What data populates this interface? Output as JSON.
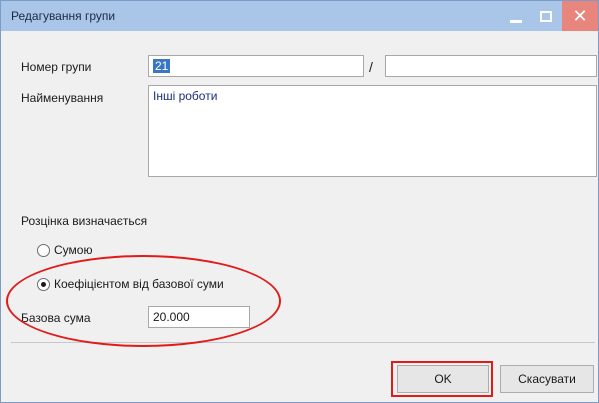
{
  "window": {
    "title": "Редагування групи",
    "controls": {
      "minimize_icon": "minimize-icon",
      "maximize_icon": "maximize-icon",
      "close_icon": "close-icon"
    }
  },
  "form": {
    "group_number_label": "Номер групи",
    "group_number_value": "21",
    "separator": "/",
    "group_suffix_value": "",
    "name_label": "Найменування",
    "name_value": "Інші роботи",
    "pricing_label": "Розцінка визначається",
    "options": [
      {
        "label": "Сумою",
        "selected": false
      },
      {
        "label": "Коефіцієнтом від базової суми",
        "selected": true
      }
    ],
    "base_sum_label": "Базова сума",
    "base_sum_value": "20.000"
  },
  "buttons": {
    "ok_label": "OK",
    "cancel_label": "Скасувати"
  },
  "colors": {
    "titlebar": "#a9c6e8",
    "close_button": "#e8867e",
    "annotation": "#e11a1a",
    "selection": "#3a76c6"
  }
}
